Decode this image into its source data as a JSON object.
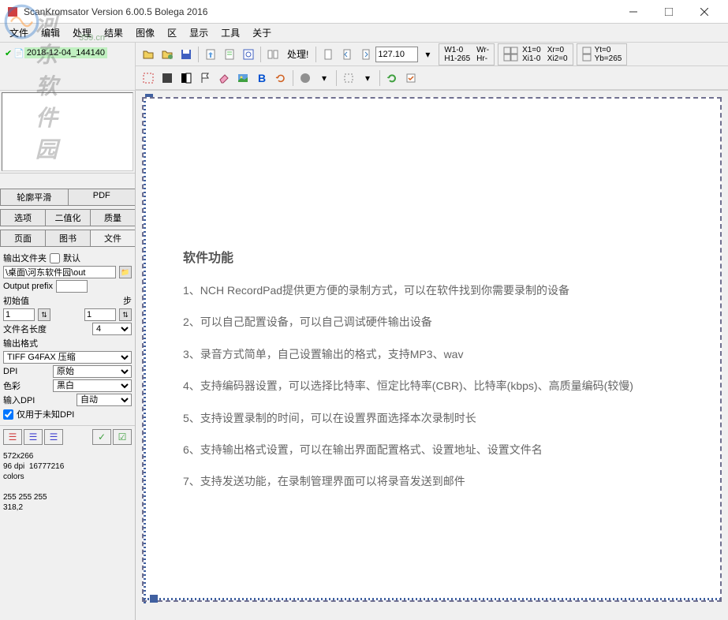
{
  "watermark": {
    "text": "河东软件园",
    "url": "359.cn"
  },
  "titlebar": {
    "title": "ScanKromsator      Version 6.00.5      Bolega 2016"
  },
  "menu": [
    "文件",
    "编辑",
    "处理",
    "结果",
    "图像",
    "区",
    "显示",
    "工具",
    "关于"
  ],
  "file_tab": {
    "name": "2018-12-04_144140"
  },
  "toolbar": {
    "zoom_value": "127.10",
    "process_label": "处理!",
    "coords1": {
      "w1": "W1-0",
      "h1": "H1-265",
      "wr": "Wr-",
      "hr": "Hr-"
    },
    "coords2": {
      "x1": "X1=0",
      "xi1": "Xi1-0",
      "xr": "Xr=0",
      "xi2": "Xi2=0"
    },
    "coords3": {
      "yt": "Yt=0",
      "yb": "Yb=265"
    }
  },
  "sidebar": {
    "tabs_row1": [
      "轮廓平滑",
      "PDF"
    ],
    "tabs_row2": [
      "选项",
      "二值化",
      "质量"
    ],
    "tabs_row3": [
      "页面",
      "图书",
      "文件"
    ],
    "output_folder_label": "输出文件夹",
    "default_label": "默认",
    "output_path": "\\桌面\\河东软件园\\out",
    "output_prefix_label": "Output prefix",
    "output_prefix_value": "",
    "initial_label": "初始值",
    "step_label": "步",
    "initial_value": "1",
    "step_value": "1",
    "filename_length_label": "文件名长度",
    "filename_length_value": "4",
    "output_format_label": "输出格式",
    "output_format_value": "TIFF G4FAX 压缩",
    "dpi_label": "DPI",
    "dpi_value": "原始",
    "color_label": "色彩",
    "color_value": "黑白",
    "input_dpi_label": "输入DPI",
    "input_dpi_value": "自动",
    "unknown_dpi_label": "仅用于未知DPI",
    "info": {
      "dims": "572x266",
      "dpi": "96 dpi",
      "colors_count": "16777216",
      "colors_label": "colors",
      "rgb": "255 255 255",
      "pos": "318,2"
    }
  },
  "document": {
    "title": "软件功能",
    "lines": [
      "1、NCH RecordPad提供更方便的录制方式，可以在软件找到你需要录制的设备",
      "2、可以自己配置设备，可以自己调试硬件输出设备",
      "3、录音方式简单，自己设置输出的格式，支持MP3、wav",
      "4、支持编码器设置，可以选择比特率、恒定比特率(CBR)、比特率(kbps)、高质量编码(较慢)",
      "5、支持设置录制的时间，可以在设置界面选择本次录制时长",
      "6、支持输出格式设置，可以在输出界面配置格式、设置地址、设置文件名",
      "7、支持发送功能，在录制管理界面可以将录音发送到邮件"
    ]
  }
}
